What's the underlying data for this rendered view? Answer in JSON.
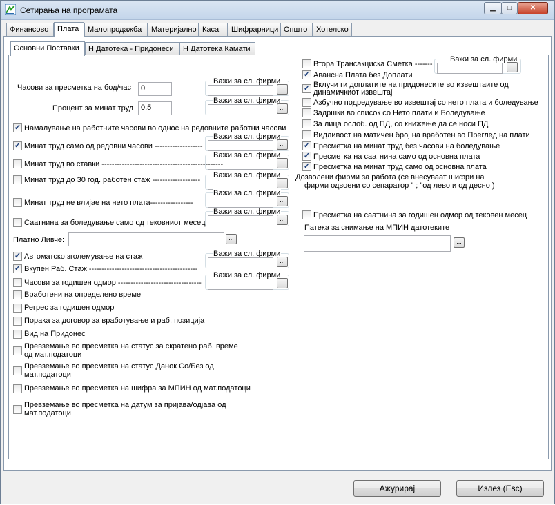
{
  "window": {
    "title": "Сетирања на програмата"
  },
  "tabs": [
    "Финансово",
    "Плата",
    "Малопродажба",
    "Материјално",
    "Каса",
    "Шифрарници",
    "Општо",
    "Хотелско"
  ],
  "subtabs": [
    "Основни Поставки",
    "Н Датотека - Придонеси",
    "Н Датотека Камати"
  ],
  "vazi": "Важи за сл. фирми",
  "dots": "...",
  "left": {
    "hours_label": "Часови за пресметка на бод/час",
    "hours_value": "0",
    "percent_label": "Процент за минат труд",
    "percent_value": "0.5",
    "reduce_hours": "Намалување на работните часови во однос на редовните работни часови",
    "minat_regular": "Минат труд само од редовни часови -------------------",
    "minat_stavki": "Минат труд во ставки ------------------------------------------------",
    "minat_30": "Минат труд до 30 год. работен стаж -------------------",
    "minat_ne_vlijae": "Минат труд не влијае на нето плата-----------------",
    "saatnina_boleduvanje": "Саатнина за боледување само од тековниот месец",
    "platno_livche": "Платно Ливче:",
    "auto_zgol": "Автоматско зголемување на стаж",
    "vkupen_rab": "Вкупен Раб. Стаж -------------------------------------------",
    "chasovi_odmor": "Часови за годишен одмор ---------------------------------",
    "vraboteni_opr": "Вработени на определено време",
    "regres": "Регрес за годишен одмор",
    "poraka": "Порака за договор за вработување и раб. позиција",
    "vid_pridones": "Вид на Придонес",
    "prev_status_l1": "Превземање во пресметка на статус за скратено раб. време",
    "prev_status_l2": "од мат.податоци",
    "prev_danok_l1": "Превземање во пресметка на статус Данок Со/Без од",
    "prev_danok_l2": "мат.податоци",
    "prev_sifra": "Превземање во пресметка на шифра за МПИН од мат.податоци",
    "prev_datum_l1": "Превземање во пресметка на датум за пријава/одјава од",
    "prev_datum_l2": "мат.податоци"
  },
  "right": {
    "vtora_smetka": "Втора Трансакциска Сметка -------",
    "avansna": "Авансна Плата без Доплати",
    "vkluchi_l1": "Вклучи ги доплатите на придонесите во извештаите од",
    "vkluchi_l2": "динамичкиот извештај",
    "azbuchno": "Азбучно подредување во извештај со нето плата и боледување",
    "zadrshki": "Задршки во список со Нето плати и Боледување",
    "za_lica": "За лица ослоб. од ПД, со книжење да се носи ПД",
    "vidlivost": "Видливост на матичен број на вработен во Преглед на плати",
    "presmetka_minat_bez": "Пресметка на минат труд без часови на боледување",
    "presmetka_saatnina": "Пресметка на саатнина само од основна плата",
    "presmetka_minat_osnovna": "Пресметка на минат труд само од основна плата",
    "dozvoleni_l1": "Дозволени фирми за работа (се внесуваат шифри на",
    "dozvoleni_l2": "фирми одвоени со сепаратор \" ; \"од лево и од десно )",
    "presmetka_saatnina_odmor": "Пресметка на саатнина за годишен одмор од тековен месец",
    "pateka": "Патека за снимање на МПИН датотеките"
  },
  "buttons": {
    "azuriraj": "Ажурирај",
    "izlez": "Излез (Esc)"
  }
}
